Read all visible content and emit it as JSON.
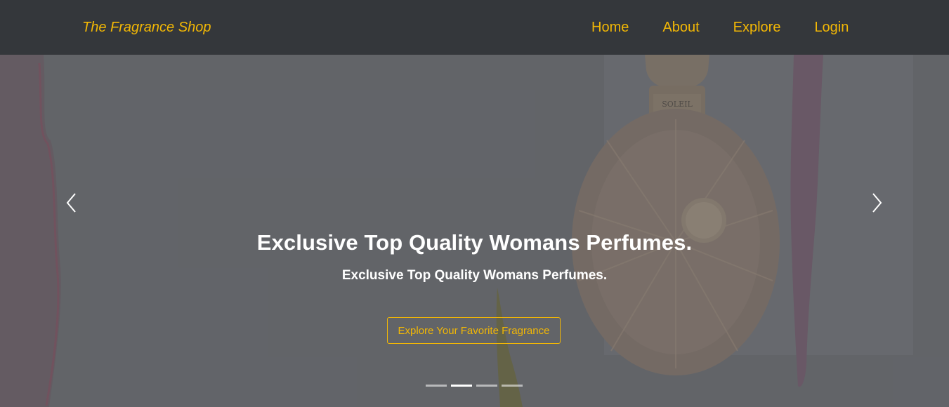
{
  "navbar": {
    "brand": "The Fragrance Shop",
    "links": [
      "Home",
      "About",
      "Explore",
      "Login"
    ]
  },
  "hero": {
    "title": "Exclusive Top Quality Womans Perfumes.",
    "subtitle": "Exclusive Top Quality Womans Perfumes.",
    "cta_label": "Explore Your Favorite Fragrance",
    "bottle_label": "SOLEIL",
    "slide_count": 4,
    "active_slide": 2
  },
  "colors": {
    "accent": "#f2b705",
    "navbar_bg": "#34373b",
    "hero_bg": "#696b70",
    "text": "#ffffff"
  },
  "icons": {
    "prev": "chevron-left-icon",
    "next": "chevron-right-icon"
  }
}
